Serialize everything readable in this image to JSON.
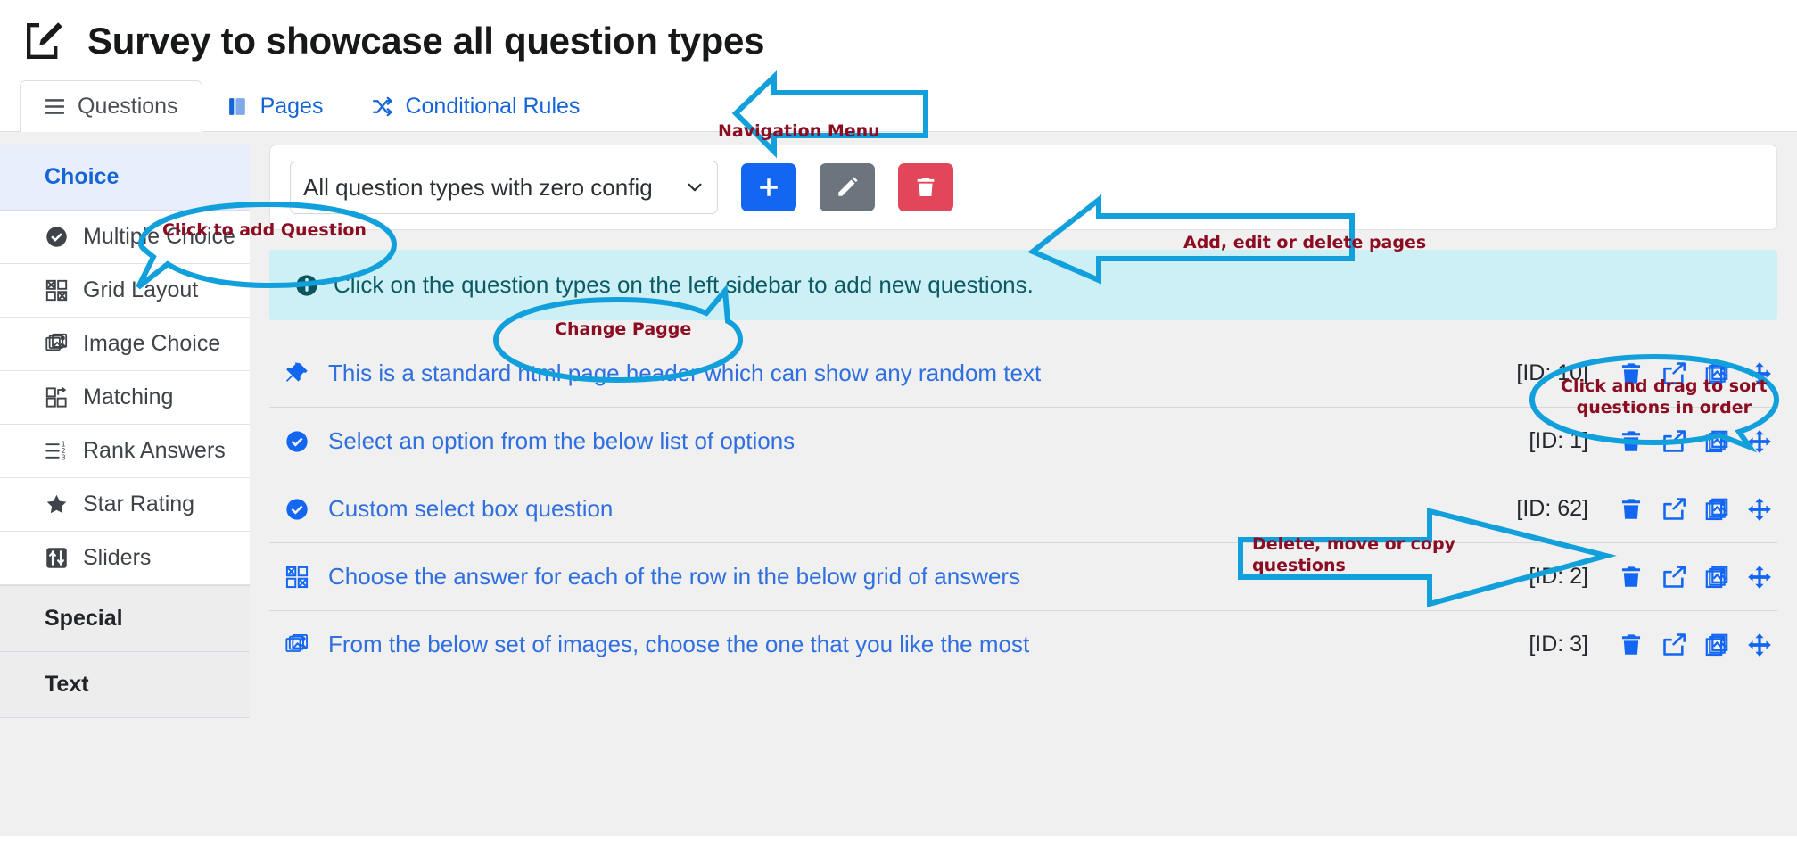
{
  "header": {
    "title": "Survey to showcase all question types",
    "icon": "edit-square-icon"
  },
  "nav": {
    "tabs": [
      {
        "label": "Questions",
        "icon": "hamburger-icon",
        "active": true
      },
      {
        "label": "Pages",
        "icon": "book-icon",
        "active": false
      },
      {
        "label": "Conditional Rules",
        "icon": "shuffle-icon",
        "active": false
      }
    ]
  },
  "sidebar": {
    "groups": [
      {
        "title": "Choice",
        "highlighted": true,
        "items": [
          {
            "label": "Multiple Choice",
            "icon": "check-circle-icon"
          },
          {
            "label": "Grid Layout",
            "icon": "grid-icon"
          },
          {
            "label": "Image Choice",
            "icon": "images-icon"
          },
          {
            "label": "Matching",
            "icon": "matching-icon"
          },
          {
            "label": "Rank Answers",
            "icon": "rank-list-icon"
          },
          {
            "label": "Star Rating",
            "icon": "star-icon"
          },
          {
            "label": "Sliders",
            "icon": "sliders-icon"
          }
        ]
      },
      {
        "title": "Special",
        "highlighted": false,
        "items": []
      },
      {
        "title": "Text",
        "highlighted": false,
        "items": []
      }
    ]
  },
  "toolbar": {
    "page_select_value": "All question types with zero config",
    "buttons": [
      {
        "name": "add-page-button",
        "icon": "plus-icon",
        "color": "#1266f1"
      },
      {
        "name": "edit-page-button",
        "icon": "pencil-icon",
        "color": "#6c757d"
      },
      {
        "name": "delete-page-button",
        "icon": "trash-icon",
        "color": "#e2465b"
      }
    ]
  },
  "info_banner": {
    "icon": "info-circle-icon",
    "text": "Click on the question types on the left sidebar to add new questions."
  },
  "questions": [
    {
      "icon": "pin-icon",
      "text": "This is a standard html page header which can show any random text",
      "id_label": "[ID: 10]"
    },
    {
      "icon": "check-circle-icon",
      "text": "Select an option from the below list of options",
      "id_label": "[ID: 1]"
    },
    {
      "icon": "check-circle-icon",
      "text": "Custom select box question",
      "id_label": "[ID: 62]"
    },
    {
      "icon": "grid-icon",
      "text": "Choose the answer for each of the row in the below grid of answers",
      "id_label": "[ID: 2]"
    },
    {
      "icon": "images-icon",
      "text": "From the below set of images, choose the one that you like the most",
      "id_label": "[ID: 3]"
    }
  ],
  "row_actions": [
    {
      "name": "delete-question-icon",
      "icon": "trash-icon"
    },
    {
      "name": "move-question-icon",
      "icon": "share-arrow-icon"
    },
    {
      "name": "copy-question-icon",
      "icon": "copy-images-icon"
    },
    {
      "name": "drag-question-icon",
      "icon": "arrows-move-icon"
    }
  ],
  "annotations": {
    "accent_color": "#12a0dd",
    "text_color": "#8c0d22",
    "items": [
      {
        "name": "annotation-navigation-menu",
        "text": "Navigation Menu"
      },
      {
        "name": "annotation-add-question",
        "text": "Click to add Question"
      },
      {
        "name": "annotation-change-page",
        "text": "Change Pagge"
      },
      {
        "name": "annotation-page-actions",
        "text": "Add, edit or delete pages"
      },
      {
        "name": "annotation-sort-questions",
        "text": "Click and drag to sort\nquestions in order"
      },
      {
        "name": "annotation-row-actions",
        "text": "Delete, move or copy\nquestions"
      }
    ]
  }
}
